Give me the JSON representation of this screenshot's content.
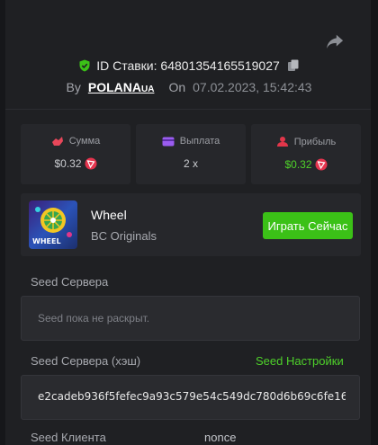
{
  "header": {
    "bet_id_label": "ID Ставки: 64801354165519027",
    "by_label": "By",
    "username": "POLANA",
    "username_suffix": "UA",
    "on_label": "On",
    "date": "07.02.2023, 15:42:43"
  },
  "stats": [
    {
      "label": "Сумма",
      "value": "$0.32",
      "icon": "amount-icon"
    },
    {
      "label": "Выплата",
      "value": "2 x",
      "icon": "payout-icon"
    },
    {
      "label": "Прибыль",
      "value": "$0.32",
      "icon": "profit-icon"
    }
  ],
  "game": {
    "title": "Wheel",
    "provider": "BC Originals",
    "play_label": "Играть Сейчас",
    "thumb_text": "WHEEL"
  },
  "seeds": {
    "server_seed_label": "Seed Сервера",
    "server_seed_placeholder": "Seed пока не раскрыт.",
    "server_hash_label": "Seed Сервера (хэш)",
    "seed_settings_label": "Seed Настройки",
    "server_hash_value": "e2cadeb936f5fefec9a93c579e54c549dc780d6b69c6fe16",
    "client_seed_label": "Seed Клиента",
    "nonce_label": "nonce"
  },
  "colors": {
    "accent_green": "#3bc117",
    "profit_green": "#4ed12a",
    "amount_icon": "#e8475a",
    "payout_icon": "#9a5cf0",
    "profit_icon": "#e2364a",
    "trx_red": "#e5344e"
  }
}
